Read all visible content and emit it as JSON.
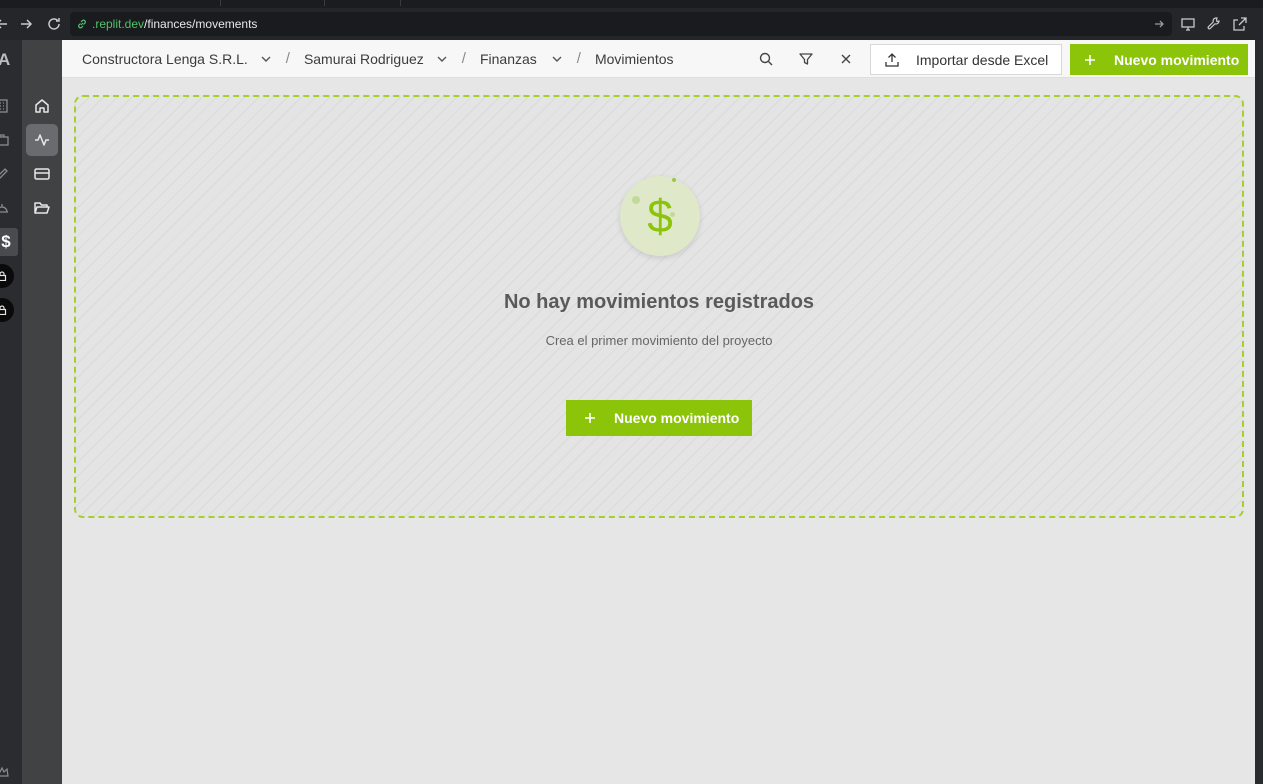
{
  "browser": {
    "url_domain": ".replit.dev",
    "url_path": "/finances/movements"
  },
  "sidebar": {
    "outer_letter": "A",
    "active_symbol": "$",
    "items": [
      {
        "name": "home-icon"
      },
      {
        "name": "activity-icon"
      },
      {
        "name": "card-icon"
      },
      {
        "name": "folder-open-icon"
      }
    ]
  },
  "header": {
    "breadcrumb": {
      "company": "Constructora Lenga S.R.L.",
      "person": "Samurai Rodriguez",
      "section": "Finanzas",
      "page": "Movimientos",
      "separator": "/"
    },
    "import_label": "Importar desde Excel",
    "new_label": "Nuevo movimiento"
  },
  "empty_state": {
    "icon": "$",
    "title": "No hay movimientos registrados",
    "subtitle": "Crea el primer movimiento del proyecto",
    "cta_label": "Nuevo movimiento"
  },
  "colors": {
    "accent": "#8cc40a",
    "url_domain": "#4ec36a"
  }
}
